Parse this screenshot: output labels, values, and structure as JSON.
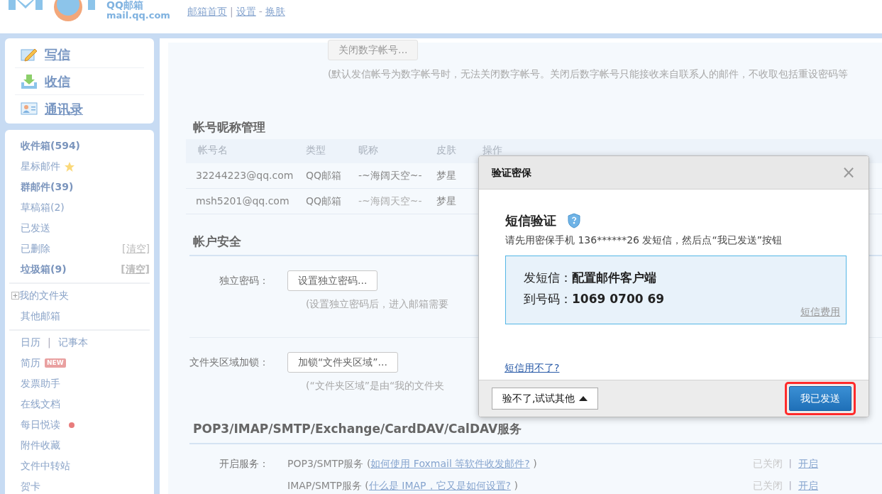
{
  "header": {
    "logo_title": "QQ邮箱",
    "logo_domain": "mail.qq.com",
    "links": [
      {
        "label": "邮箱首页"
      },
      {
        "label": "设置",
        "separator_before": "|"
      },
      {
        "label": "换肤",
        "separator_before": "-"
      }
    ]
  },
  "quick_actions": [
    {
      "label": "写信",
      "kind": "compose"
    },
    {
      "label": "收信",
      "kind": "receive"
    },
    {
      "label": "通讯录",
      "kind": "contacts"
    }
  ],
  "folder_groups": [
    [
      {
        "label": "收件箱(594)",
        "bold": true
      },
      {
        "label": "星标邮件",
        "bold": false,
        "kind": "star"
      },
      {
        "label": "群邮件(39)",
        "bold": true
      },
      {
        "label": "草稿箱(2)",
        "bold": false
      },
      {
        "label": "已发送",
        "bold": false
      },
      {
        "label": "已删除",
        "bold": false,
        "action": "[清空]"
      },
      {
        "label": "垃圾箱(9)",
        "bold": true,
        "action": "[清空]"
      }
    ],
    [
      {
        "label": "我的文件夹",
        "bold": false,
        "kind": "expandable",
        "expanded": false
      },
      {
        "label": "其他邮箱",
        "bold": false
      }
    ],
    [
      {
        "label": "日历",
        "bold": false,
        "kind": "pair",
        "separator": "|",
        "second": "记事本"
      },
      {
        "label": "简历",
        "bold": false,
        "kind": "tag",
        "tag": "NEW"
      },
      {
        "label": "发票助手",
        "bold": false
      },
      {
        "label": "在线文档",
        "bold": false
      },
      {
        "label": "每日悦读",
        "bold": false,
        "kind": "dot",
        "color": "#e87c7c"
      },
      {
        "label": "附件收藏",
        "bold": false
      },
      {
        "label": "文件中转站",
        "bold": false
      },
      {
        "label": "贺卡",
        "bold": false
      }
    ]
  ],
  "digital_account": {
    "button": "关闭数字帐号...",
    "button_disabled": true,
    "note": "(默认发信帐号为数字帐号时，无法关闭数字帐号。关闭后数字帐号只能接收来自联系人的邮件，不收取包括重设密码等"
  },
  "nickname_section": {
    "title": "帐号昵称管理",
    "columns": [
      "帐号名",
      "类型",
      "昵称",
      "皮肤",
      "操作"
    ],
    "rows": [
      {
        "account": "32244223@qq.com",
        "type": "QQ邮箱",
        "nickname": "-~海阔天空~-",
        "nickname_dimmed": false,
        "skin": "梦星"
      },
      {
        "account": "msh5201@qq.com",
        "type": "QQ邮箱",
        "nickname": "-~海阔天空~-",
        "nickname_dimmed": true,
        "skin": "梦星"
      }
    ]
  },
  "security": {
    "title": "帐户安全",
    "rows": [
      {
        "label": "独立密码：",
        "button": "设置独立密码...",
        "note": "(设置独立密码后，进入邮箱需要"
      },
      {
        "label": "文件夹区域加锁：",
        "button": "加锁“文件夹区域”...",
        "note": "(“文件夹区域”是由“我的文件夹"
      }
    ]
  },
  "services": {
    "title": "POP3/IMAP/SMTP/Exchange/CardDAV/CalDAV服务",
    "label": "开启服务：",
    "rows": [
      {
        "name": "POP3/SMTP服务 (",
        "help": "如何使用 Foxmail 等软件收发邮件?",
        "close": ")",
        "status": "已关闭",
        "separator": "|",
        "action": "开启"
      },
      {
        "name": "IMAP/SMTP服务 (",
        "help": "什么是 IMAP，它又是如何设置?",
        "close": ")",
        "status": "已关闭",
        "separator": "|",
        "action": "开启"
      }
    ]
  },
  "dialog": {
    "title": "验证密保",
    "close": "×",
    "heading": "短信验证",
    "instruction": "请先用密保手机 136******26 发短信，然后点“我已发送”按钮",
    "sms_label": "发短信：",
    "sms_content": "配置邮件客户端",
    "to_label": "到号码：",
    "to_number": "1069 0700 69",
    "fee_link": "短信费用",
    "help_link": "短信用不了?",
    "other_button": "验不了,试试其他",
    "confirm_button": "我已发送",
    "confirm_highlighted": true
  }
}
